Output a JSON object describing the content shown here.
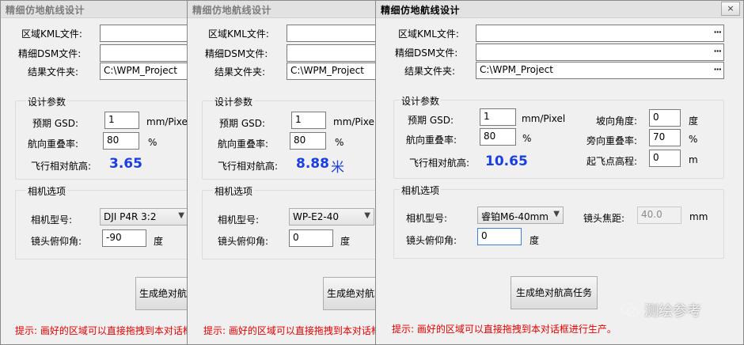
{
  "windows": [
    {
      "title": "精细仿地航线设计",
      "kml_label": "区域KML文件:",
      "kml_value": "",
      "dsm_label": "精细DSM文件:",
      "dsm_value": "",
      "result_label": "结果文件夹:",
      "result_value": "C:\\WPM_Project",
      "design_group": "设计参数",
      "gsd_label": "预期 GSD:",
      "gsd_value": "1",
      "gsd_unit": "mm/Pixel",
      "overlap_label": "航向重叠率:",
      "overlap_value": "80",
      "overlap_unit": "%",
      "height_label": "飞行相对航高:",
      "height_value": "3.65",
      "camera_group": "相机选项",
      "camera_label": "相机型号:",
      "camera_value": "DJI P4R 3:2",
      "pitch_label": "镜头俯仰角:",
      "pitch_value": "-90",
      "pitch_unit": "度",
      "generate_label": "生成绝对航高任务",
      "hint": "提示: 画好的区域可以直接拖拽到本对话框进行生产。"
    },
    {
      "title": "精细仿地航线设计",
      "kml_label": "区域KML文件:",
      "kml_value": "",
      "dsm_label": "精细DSM文件:",
      "dsm_value": "",
      "result_label": "结果文件夹:",
      "result_value": "C:\\WPM_Project",
      "design_group": "设计参数",
      "gsd_label": "预期 GSD:",
      "gsd_value": "1",
      "gsd_unit": "mm/Pixel",
      "overlap_label": "航向重叠率:",
      "overlap_value": "80",
      "overlap_unit": "%",
      "height_label": "飞行相对航高:",
      "height_value": "8.88",
      "height_unit": "米",
      "camera_group": "相机选项",
      "camera_label": "相机型号:",
      "camera_value": "WP-E2-40",
      "pitch_label": "镜头俯仰角:",
      "pitch_value": "0",
      "pitch_unit": "度",
      "generate_label": "生成绝对航高任务",
      "hint": "提示: 画好的区域可以直接拖拽到本对话框进行生产。"
    },
    {
      "title": "精细仿地航线设计",
      "close_glyph": "×",
      "kml_label": "区域KML文件:",
      "kml_value": "",
      "dsm_label": "精细DSM文件:",
      "dsm_value": "",
      "result_label": "结果文件夹:",
      "result_value": "C:\\WPM_Project",
      "browse_glyph": "···",
      "design_group": "设计参数",
      "gsd_label": "预期 GSD:",
      "gsd_value": "1",
      "gsd_unit": "mm/Pixel",
      "overlap_label": "航向重叠率:",
      "overlap_value": "80",
      "overlap_unit": "%",
      "height_label": "飞行相对航高:",
      "height_value": "10.65",
      "slope_label": "坡向角度:",
      "slope_value": "0",
      "slope_unit": "度",
      "side_overlap_label": "旁向重叠率:",
      "side_overlap_value": "70",
      "side_overlap_unit": "%",
      "takeoff_label": "起飞点高程:",
      "takeoff_value": "0",
      "takeoff_unit": "m",
      "camera_group": "相机选项",
      "camera_label": "相机型号:",
      "camera_value": "睿铂M6-40mm",
      "focal_label": "镜头焦距:",
      "focal_value": "40.0",
      "focal_unit": "mm",
      "pitch_label": "镜头俯仰角:",
      "pitch_value": "0",
      "pitch_unit": "度",
      "generate_label": "生成绝对航高任务",
      "hint": "提示: 画好的区域可以直接拖拽到本对话框进行生产。"
    }
  ],
  "watermark": "测绘参考",
  "colors": {
    "height_blue": "#1b3ee0",
    "hint_red": "#e00000",
    "window_bg": "#f0f0f0"
  }
}
